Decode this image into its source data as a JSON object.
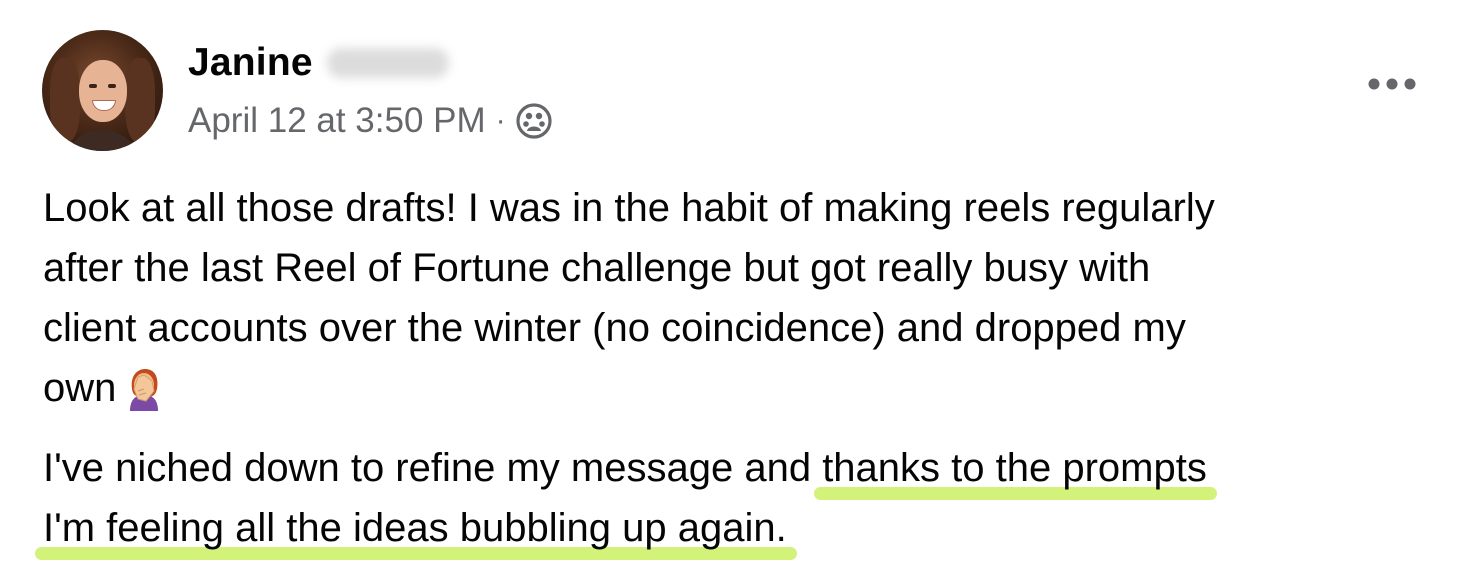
{
  "post": {
    "author_first": "Janine",
    "timestamp": "April 12 at 3:50 PM",
    "separator": "·",
    "audience_icon": "group-icon",
    "more_icon": "more-options-icon",
    "body_p1_line1": "Look at all those drafts! I was in the habit of making reels regularly",
    "body_p1_line2": "after the last Reel of Fortune challenge but got really busy with",
    "body_p1_line3": "client accounts over the winter (no coincidence) and dropped my",
    "body_p1_line4": "own",
    "emoji": "person-facepalming-emoji",
    "body_p2_line1_start": "I've niched down to refine my message and ",
    "body_p2_line1_highlight": "thanks to the prompts",
    "body_p2_line2_highlight": "I'm feeling all the ideas bubbling up again."
  },
  "colors": {
    "text": "#050505",
    "meta": "#65676b",
    "highlight": "#d2f27a"
  }
}
